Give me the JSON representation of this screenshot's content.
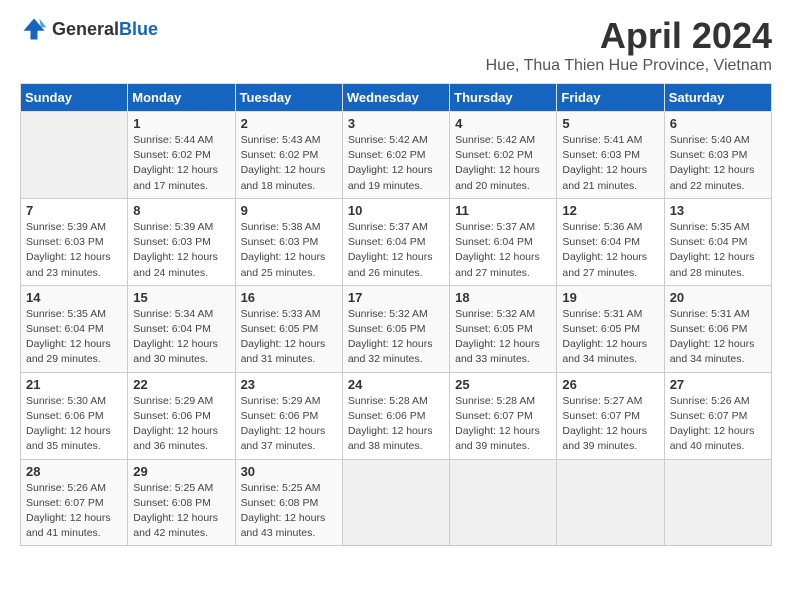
{
  "header": {
    "logo_general": "General",
    "logo_blue": "Blue",
    "month_title": "April 2024",
    "location": "Hue, Thua Thien Hue Province, Vietnam"
  },
  "weekdays": [
    "Sunday",
    "Monday",
    "Tuesday",
    "Wednesday",
    "Thursday",
    "Friday",
    "Saturday"
  ],
  "weeks": [
    [
      {
        "day": "",
        "info": ""
      },
      {
        "day": "1",
        "info": "Sunrise: 5:44 AM\nSunset: 6:02 PM\nDaylight: 12 hours\nand 17 minutes."
      },
      {
        "day": "2",
        "info": "Sunrise: 5:43 AM\nSunset: 6:02 PM\nDaylight: 12 hours\nand 18 minutes."
      },
      {
        "day": "3",
        "info": "Sunrise: 5:42 AM\nSunset: 6:02 PM\nDaylight: 12 hours\nand 19 minutes."
      },
      {
        "day": "4",
        "info": "Sunrise: 5:42 AM\nSunset: 6:02 PM\nDaylight: 12 hours\nand 20 minutes."
      },
      {
        "day": "5",
        "info": "Sunrise: 5:41 AM\nSunset: 6:03 PM\nDaylight: 12 hours\nand 21 minutes."
      },
      {
        "day": "6",
        "info": "Sunrise: 5:40 AM\nSunset: 6:03 PM\nDaylight: 12 hours\nand 22 minutes."
      }
    ],
    [
      {
        "day": "7",
        "info": "Sunrise: 5:39 AM\nSunset: 6:03 PM\nDaylight: 12 hours\nand 23 minutes."
      },
      {
        "day": "8",
        "info": "Sunrise: 5:39 AM\nSunset: 6:03 PM\nDaylight: 12 hours\nand 24 minutes."
      },
      {
        "day": "9",
        "info": "Sunrise: 5:38 AM\nSunset: 6:03 PM\nDaylight: 12 hours\nand 25 minutes."
      },
      {
        "day": "10",
        "info": "Sunrise: 5:37 AM\nSunset: 6:04 PM\nDaylight: 12 hours\nand 26 minutes."
      },
      {
        "day": "11",
        "info": "Sunrise: 5:37 AM\nSunset: 6:04 PM\nDaylight: 12 hours\nand 27 minutes."
      },
      {
        "day": "12",
        "info": "Sunrise: 5:36 AM\nSunset: 6:04 PM\nDaylight: 12 hours\nand 27 minutes."
      },
      {
        "day": "13",
        "info": "Sunrise: 5:35 AM\nSunset: 6:04 PM\nDaylight: 12 hours\nand 28 minutes."
      }
    ],
    [
      {
        "day": "14",
        "info": "Sunrise: 5:35 AM\nSunset: 6:04 PM\nDaylight: 12 hours\nand 29 minutes."
      },
      {
        "day": "15",
        "info": "Sunrise: 5:34 AM\nSunset: 6:04 PM\nDaylight: 12 hours\nand 30 minutes."
      },
      {
        "day": "16",
        "info": "Sunrise: 5:33 AM\nSunset: 6:05 PM\nDaylight: 12 hours\nand 31 minutes."
      },
      {
        "day": "17",
        "info": "Sunrise: 5:32 AM\nSunset: 6:05 PM\nDaylight: 12 hours\nand 32 minutes."
      },
      {
        "day": "18",
        "info": "Sunrise: 5:32 AM\nSunset: 6:05 PM\nDaylight: 12 hours\nand 33 minutes."
      },
      {
        "day": "19",
        "info": "Sunrise: 5:31 AM\nSunset: 6:05 PM\nDaylight: 12 hours\nand 34 minutes."
      },
      {
        "day": "20",
        "info": "Sunrise: 5:31 AM\nSunset: 6:06 PM\nDaylight: 12 hours\nand 34 minutes."
      }
    ],
    [
      {
        "day": "21",
        "info": "Sunrise: 5:30 AM\nSunset: 6:06 PM\nDaylight: 12 hours\nand 35 minutes."
      },
      {
        "day": "22",
        "info": "Sunrise: 5:29 AM\nSunset: 6:06 PM\nDaylight: 12 hours\nand 36 minutes."
      },
      {
        "day": "23",
        "info": "Sunrise: 5:29 AM\nSunset: 6:06 PM\nDaylight: 12 hours\nand 37 minutes."
      },
      {
        "day": "24",
        "info": "Sunrise: 5:28 AM\nSunset: 6:06 PM\nDaylight: 12 hours\nand 38 minutes."
      },
      {
        "day": "25",
        "info": "Sunrise: 5:28 AM\nSunset: 6:07 PM\nDaylight: 12 hours\nand 39 minutes."
      },
      {
        "day": "26",
        "info": "Sunrise: 5:27 AM\nSunset: 6:07 PM\nDaylight: 12 hours\nand 39 minutes."
      },
      {
        "day": "27",
        "info": "Sunrise: 5:26 AM\nSunset: 6:07 PM\nDaylight: 12 hours\nand 40 minutes."
      }
    ],
    [
      {
        "day": "28",
        "info": "Sunrise: 5:26 AM\nSunset: 6:07 PM\nDaylight: 12 hours\nand 41 minutes."
      },
      {
        "day": "29",
        "info": "Sunrise: 5:25 AM\nSunset: 6:08 PM\nDaylight: 12 hours\nand 42 minutes."
      },
      {
        "day": "30",
        "info": "Sunrise: 5:25 AM\nSunset: 6:08 PM\nDaylight: 12 hours\nand 43 minutes."
      },
      {
        "day": "",
        "info": ""
      },
      {
        "day": "",
        "info": ""
      },
      {
        "day": "",
        "info": ""
      },
      {
        "day": "",
        "info": ""
      }
    ]
  ]
}
